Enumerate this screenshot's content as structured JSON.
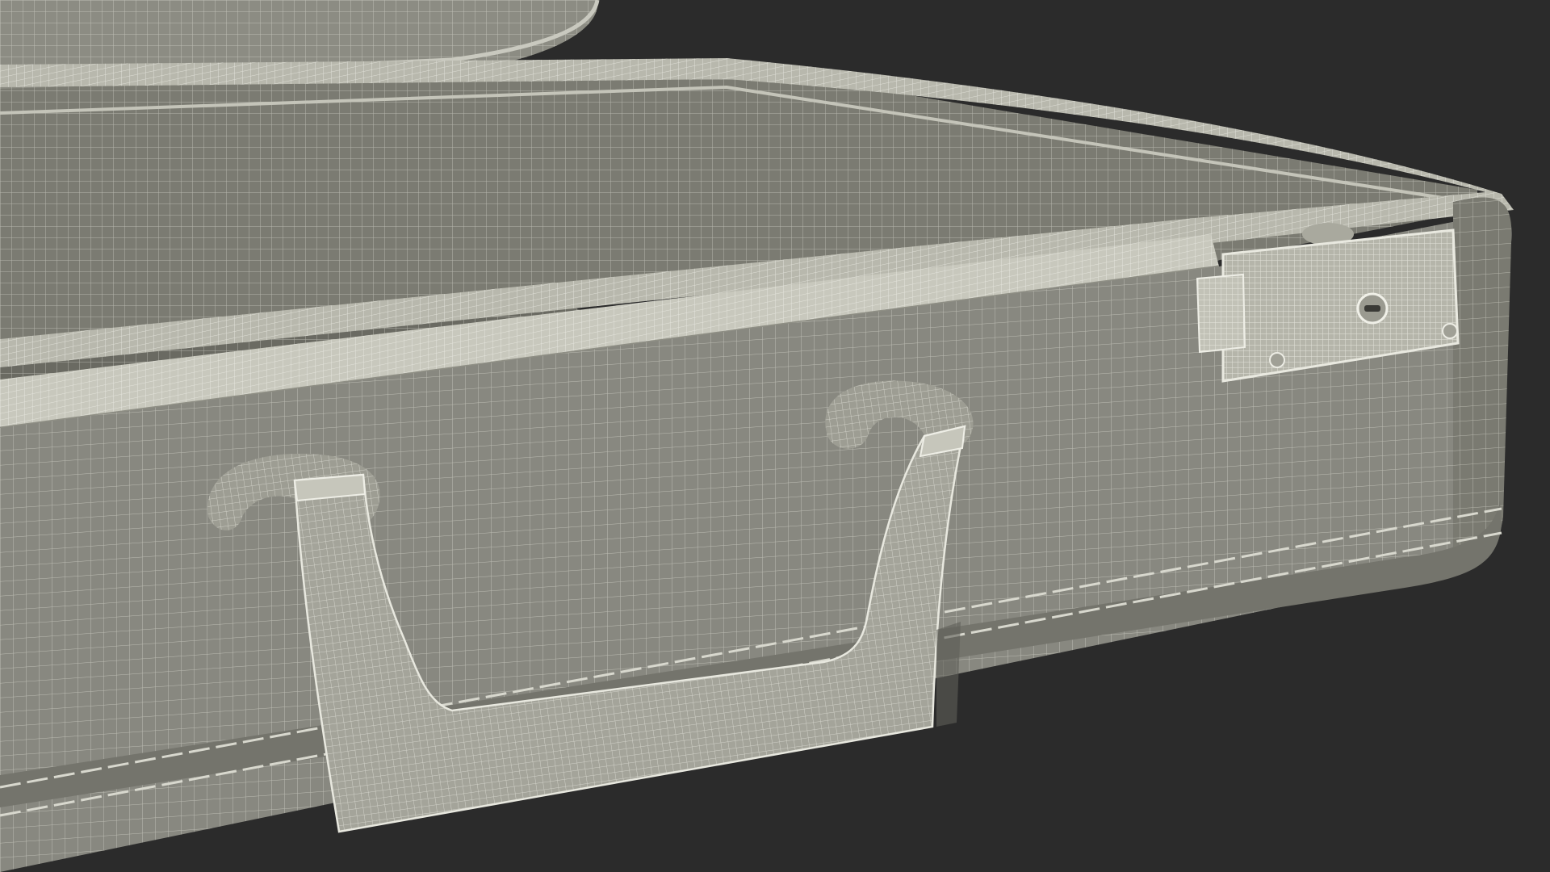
{
  "scene": {
    "subject": "open-suitcase-wireframe",
    "colors": {
      "background": "#2b2b2b",
      "shell_side": "#8a8a80",
      "shell_side_dark": "#6d6d64",
      "interior": "#7d7d74",
      "interior_dark": "#5f5f57",
      "rim": "#b9b9ae",
      "rim_light": "#d6d6cb",
      "handle": "#9c9c92",
      "latch": "#b3b3a8",
      "wire": "#e6e6dc"
    }
  }
}
